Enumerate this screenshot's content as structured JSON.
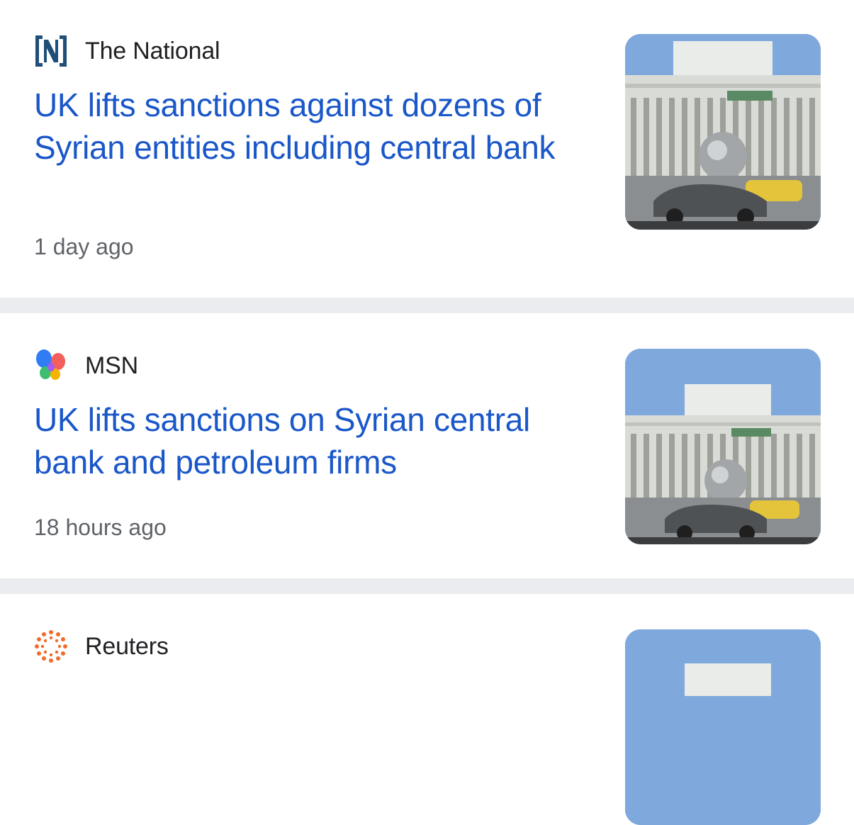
{
  "articles": [
    {
      "source": "The National",
      "source_icon": "the-national-logo-icon",
      "headline": "UK lifts sanctions against dozens of Syrian entities including central bank",
      "time": "1 day ago"
    },
    {
      "source": "MSN",
      "source_icon": "msn-butterfly-logo-icon",
      "headline": "UK lifts sanctions on Syrian central bank and petroleum firms",
      "time": "18 hours ago"
    },
    {
      "source": "Reuters",
      "source_icon": "reuters-logo-icon"
    }
  ],
  "colors": {
    "headline": "#1a57c9",
    "divider": "#ebecef",
    "time": "#5f6368",
    "source": "#202124"
  }
}
